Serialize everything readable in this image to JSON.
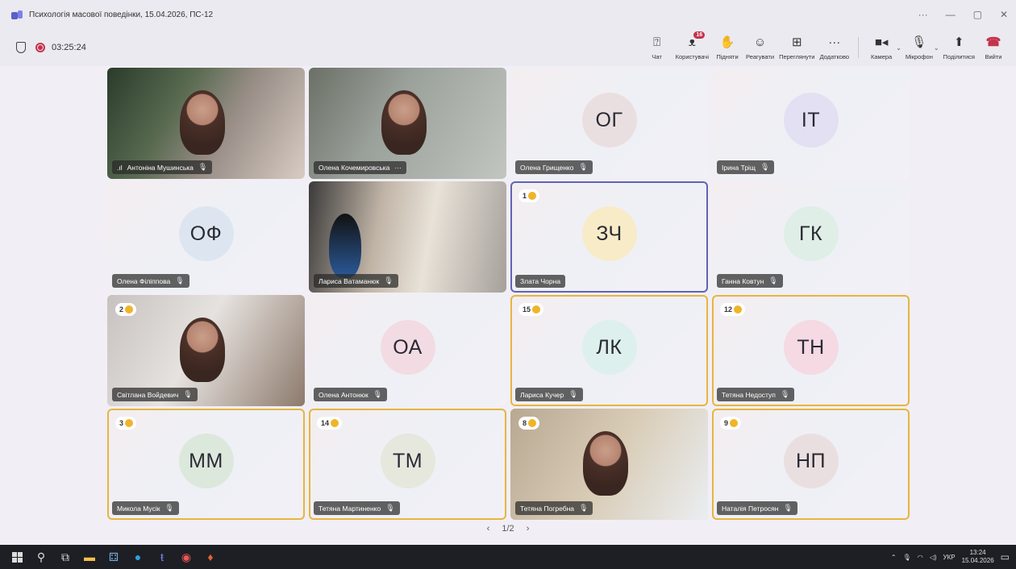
{
  "window": {
    "title": "Психологія масової поведінки, 15.04.2026, ПС-12",
    "ctrl_more": "···",
    "ctrl_min": "—",
    "ctrl_restore": "▢",
    "ctrl_close": "✕"
  },
  "meeting": {
    "timer": "03:25:24",
    "participants_badge": "16"
  },
  "toolbar": [
    {
      "label": "Чат",
      "icon": "chat-icon",
      "glyph": "☺"
    },
    {
      "label": "Користувачі",
      "icon": "people-icon",
      "glyph": "☰"
    },
    {
      "label": "Підняти",
      "icon": "raise-hand-icon",
      "glyph": "✋"
    },
    {
      "label": "Реагувати",
      "icon": "react-icon",
      "glyph": "☺"
    },
    {
      "label": "Переглянути",
      "icon": "view-icon",
      "glyph": "⊞"
    },
    {
      "label": "Додатково",
      "icon": "more-icon",
      "glyph": "···"
    }
  ],
  "devices": {
    "camera": "Камера",
    "microphone": "Мікрофон",
    "share": "Поділитися",
    "leave": "Вийти"
  },
  "participants": [
    {
      "name": "Антоніна Мушинська",
      "initials": "",
      "video": true,
      "hand": "",
      "signal": true,
      "muted": true
    },
    {
      "name": "Олена Кочемировська",
      "initials": "",
      "video": true,
      "hand": "",
      "more": "···"
    },
    {
      "name": "Олена Грищенко",
      "initials": "ОГ",
      "video": false,
      "hand": "",
      "muted": true
    },
    {
      "name": "Ірина Тріщ",
      "initials": "ІТ",
      "video": false,
      "hand": "",
      "muted": true
    },
    {
      "name": "Олена Філіппова",
      "initials": "ОФ",
      "video": false,
      "hand": "",
      "muted": true
    },
    {
      "name": "Лариса Ватаманюк",
      "initials": "",
      "video": true,
      "hand": "",
      "muted": true
    },
    {
      "name": "Злата Чорна",
      "initials": "ЗЧ",
      "video": false,
      "hand": "1",
      "muted": false,
      "active": true
    },
    {
      "name": "Ганна Ковтун",
      "initials": "ГК",
      "video": false,
      "hand": "",
      "muted": true
    },
    {
      "name": "Світлана Войдевич",
      "initials": "",
      "video": true,
      "hand": "2",
      "muted": true
    },
    {
      "name": "Олена Антонюк",
      "initials": "ОА",
      "video": false,
      "hand": "",
      "muted": true
    },
    {
      "name": "Лариса Кучер",
      "initials": "ЛК",
      "video": false,
      "hand": "15",
      "muted": true
    },
    {
      "name": "Тетяна Недоступ",
      "initials": "ТН",
      "video": false,
      "hand": "12",
      "muted": true
    },
    {
      "name": "Микола Мусік",
      "initials": "ММ",
      "video": false,
      "hand": "3",
      "muted": true
    },
    {
      "name": "Тетяна Мартиненко",
      "initials": "ТМ",
      "video": false,
      "hand": "14",
      "muted": true
    },
    {
      "name": "Тетяна Погребна",
      "initials": "",
      "video": true,
      "hand": "8",
      "muted": true
    },
    {
      "name": "Наталія Петросян",
      "initials": "НП",
      "video": false,
      "hand": "9",
      "muted": true
    }
  ],
  "pager": {
    "prev": "‹",
    "page": "1/2",
    "next": "›"
  },
  "taskbar": {
    "lang": "УКР",
    "time": "13:24",
    "date": "15.04.2026",
    "notif": "1"
  }
}
